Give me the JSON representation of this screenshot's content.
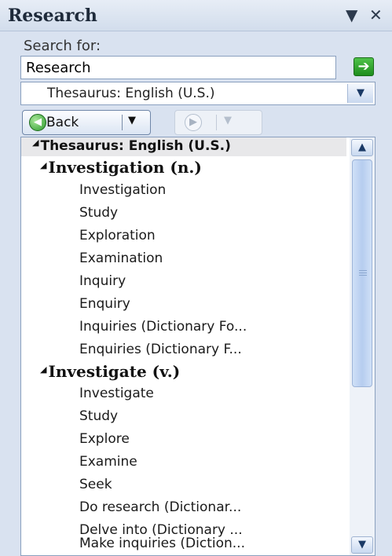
{
  "pane": {
    "title": "Research",
    "dropdown_glyph": "▼",
    "close_glyph": "✕"
  },
  "search": {
    "label": "Search for:",
    "value": "Research",
    "go_glyph": "➔"
  },
  "source": {
    "selected": "Thesaurus: English (U.S.)",
    "arrow_glyph": "▼"
  },
  "nav": {
    "back_label": "Back",
    "back_icon_glyph": "◀",
    "forward_icon_glyph": "▶",
    "dropdown_glyph": "▼"
  },
  "results": {
    "header": "Thesaurus: English (U.S.)",
    "groups": [
      {
        "title": "Investigation (n.)",
        "items": [
          "Investigation",
          "Study",
          "Exploration",
          "Examination",
          "Inquiry",
          "Enquiry",
          "Inquiries (Dictionary Fo...",
          "Enquiries (Dictionary F..."
        ]
      },
      {
        "title": "Investigate (v.)",
        "items": [
          "Investigate",
          "Study",
          "Explore",
          "Examine",
          "Seek",
          "Do research (Dictionar...",
          "Delve into (Dictionary ...",
          "Make inquiries (Diction..."
        ]
      }
    ]
  },
  "colors": {
    "pane_background": "#d9e2f0",
    "go_button": "#2aa52a",
    "selection_header": "#e8e8ea"
  },
  "icons": {
    "dropdown": "chevron-down-icon",
    "close": "close-icon",
    "go": "arrow-right-icon",
    "back": "back-arrow-icon",
    "forward": "forward-arrow-icon",
    "expand": "expand-triangle-icon"
  }
}
